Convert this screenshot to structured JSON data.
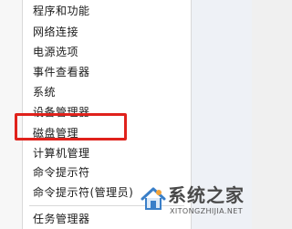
{
  "menu": {
    "items": [
      {
        "label": "程序和功能"
      },
      {
        "label": "网络连接"
      },
      {
        "label": "电源选项"
      },
      {
        "label": "事件查看器"
      },
      {
        "label": "系统"
      },
      {
        "label": "设备管理器"
      },
      {
        "label": "磁盘管理"
      },
      {
        "label": "计算机管理"
      },
      {
        "label": "命令提示符"
      },
      {
        "label": "命令提示符(管理员)"
      },
      {
        "label": "任务管理器"
      }
    ],
    "highlighted_item": "磁盘管理"
  },
  "watermark": {
    "title": "系统之家",
    "url": "XITONGZHIJIA.NET",
    "icon": "house-logo-icon"
  },
  "colors": {
    "highlight_border": "#e0221c",
    "menu_background": "#ffffff"
  }
}
